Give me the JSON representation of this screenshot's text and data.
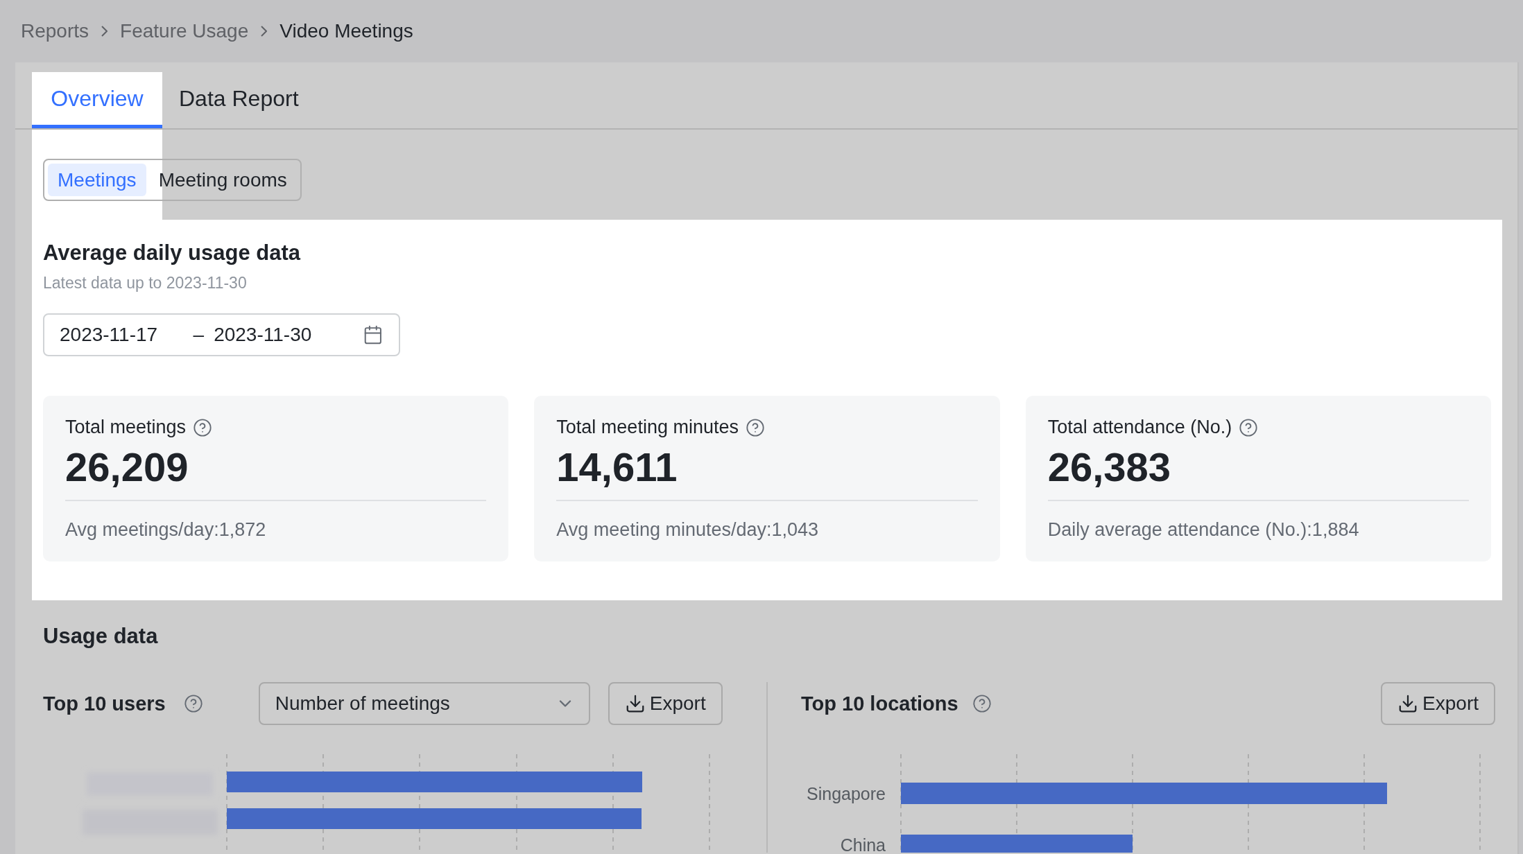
{
  "breadcrumb": [
    {
      "label": "Reports",
      "current": false
    },
    {
      "label": "Feature Usage",
      "current": false
    },
    {
      "label": "Video Meetings",
      "current": true
    }
  ],
  "tabs": [
    {
      "label": "Overview",
      "selected": true
    },
    {
      "label": "Data Report",
      "selected": false
    }
  ],
  "segments": [
    {
      "label": "Meetings",
      "selected": true
    },
    {
      "label": "Meeting rooms",
      "selected": false
    }
  ],
  "summary": {
    "title": "Average daily usage data",
    "subtitle": "Latest data up to 2023-11-30",
    "date_range": {
      "start": "2023-11-17",
      "separator": "–",
      "end": "2023-11-30"
    },
    "stats": [
      {
        "label": "Total meetings",
        "value": "26,209",
        "average": "Avg meetings/day:1,872"
      },
      {
        "label": "Total meeting minutes",
        "value": "14,611",
        "average": "Avg meeting minutes/day:1,043"
      },
      {
        "label": "Total attendance (No.)",
        "value": "26,383",
        "average": "Daily average attendance (No.):1,884"
      }
    ]
  },
  "usage": {
    "title": "Usage data",
    "top_users": {
      "title": "Top 10 users",
      "metric": "Number of meetings",
      "export": "Export"
    },
    "top_locations": {
      "title": "Top 10 locations",
      "export": "Export",
      "locations": [
        "Singapore",
        "China"
      ]
    }
  }
}
